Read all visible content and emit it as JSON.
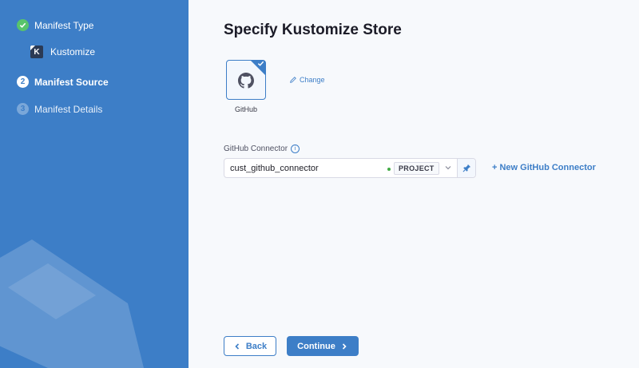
{
  "sidebar": {
    "steps": [
      {
        "label": "Manifest Type",
        "state": "done"
      },
      {
        "label": "Manifest Source",
        "number": "2",
        "state": "active"
      },
      {
        "label": "Manifest Details",
        "number": "3",
        "state": "pending"
      }
    ],
    "sub_item": {
      "label": "Kustomize",
      "logo_letter": "K"
    }
  },
  "main": {
    "title": "Specify Kustomize Store",
    "store": {
      "label": "GitHub",
      "selected": true
    },
    "change_label": "Change",
    "connector": {
      "label": "GitHub Connector",
      "value": "cust_github_connector",
      "scope": "PROJECT",
      "status_color": "#42ab45"
    },
    "new_connector_label": "+ New GitHub Connector",
    "back_label": "Back",
    "continue_label": "Continue"
  },
  "colors": {
    "accent": "#3d7ec7",
    "sidebar": "#3d7ec7",
    "done": "#58c46b"
  }
}
